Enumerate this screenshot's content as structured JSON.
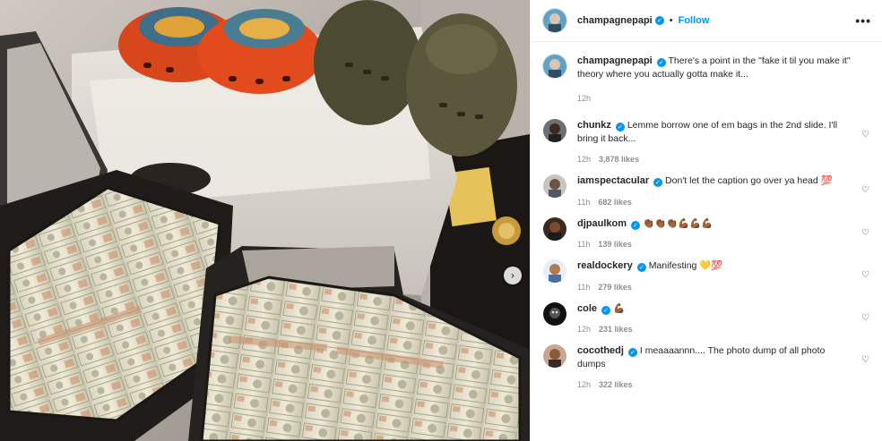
{
  "post": {
    "author": "champagnepapi",
    "follow_label": "Follow",
    "separator": "•",
    "more_label": "•••",
    "next_label": "›"
  },
  "comments": [
    {
      "user": "champagnepapi",
      "text": "There's a point in the \"fake it til you make it\" theory where you actually gotta make it...",
      "time": "12h",
      "likes": "",
      "verified": true
    },
    {
      "user": "chunkz",
      "text": "Lemme borrow one of em bags in the 2nd slide. I'll bring it back...",
      "time": "12h",
      "likes": "3,878 likes",
      "verified": true
    },
    {
      "user": "iamspectacular",
      "text": "Don't let the caption go over ya head",
      "emoji": "💯",
      "time": "11h",
      "likes": "682 likes",
      "verified": true
    },
    {
      "user": "djpaulkom",
      "text": "",
      "emoji": "👏🏾👏🏾👏🏾💪🏾💪🏾💪🏾",
      "time": "11h",
      "likes": "139 likes",
      "verified": true
    },
    {
      "user": "realdockery",
      "text": "Manifesting",
      "emoji": "💛💯",
      "time": "11h",
      "likes": "279 likes",
      "verified": true
    },
    {
      "user": "cole",
      "text": "",
      "emoji": "💪🏾",
      "time": "12h",
      "likes": "231 likes",
      "verified": true
    },
    {
      "user": "cocothedj",
      "text": "I meaaaannn.... The photo dump of all photo dumps",
      "time": "12h",
      "likes": "322 likes",
      "verified": true
    }
  ],
  "icons": {
    "heart": "heart-outline-icon",
    "verified": "verified-badge-icon"
  },
  "colors": {
    "accent": "#0095f6",
    "muted": "#8e8e8e",
    "text": "#262626"
  }
}
